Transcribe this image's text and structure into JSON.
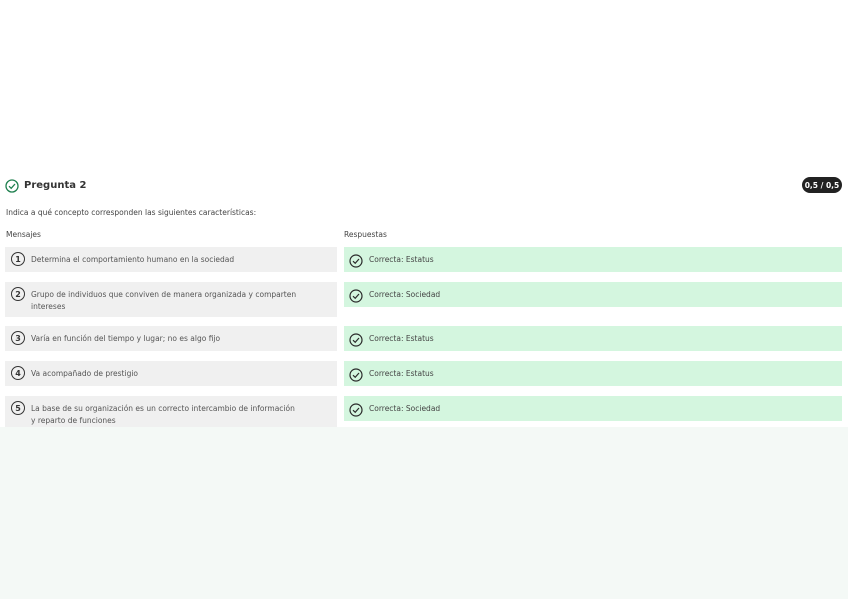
{
  "question": {
    "title": "Pregunta 2",
    "score": "0,5 / 0,5",
    "instruction": "Indica a qué concepto corresponden las siguientes características:",
    "columns": {
      "messages": "Mensajes",
      "answers": "Respuestas"
    },
    "icons": {
      "status": "check-circle-icon"
    },
    "colors": {
      "correct_bg": "#d4f6df",
      "message_bg": "#f0f0f0",
      "pill_bg": "#222222"
    }
  },
  "rows": [
    {
      "number": "1",
      "message": "Determina el comportamiento humano en la sociedad",
      "answer": "Correcta: Estatus"
    },
    {
      "number": "2",
      "message": "Grupo de individuos que conviven de manera organizada y comparten intereses",
      "answer": "Correcta: Sociedad"
    },
    {
      "number": "3",
      "message": "Varía en función del tiempo y lugar; no es algo fijo",
      "answer": "Correcta: Estatus"
    },
    {
      "number": "4",
      "message": "Va acompañado de prestigio",
      "answer": "Correcta: Estatus"
    },
    {
      "number": "5",
      "message": "La base de su organización es un correcto intercambio de información y reparto de funciones",
      "answer": "Correcta: Sociedad"
    }
  ]
}
